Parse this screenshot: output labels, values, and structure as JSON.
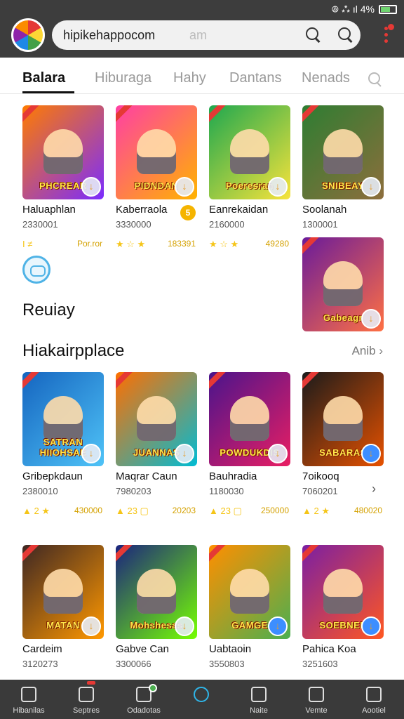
{
  "status": {
    "text": "ꔮ ⁂ ıl 4%"
  },
  "search": {
    "value": "hipikehappocom",
    "ghost": "am"
  },
  "tabs": [
    {
      "label": "Balara",
      "active": true
    },
    {
      "label": "Hiburaga",
      "active": false
    },
    {
      "label": "Hahy",
      "active": false
    },
    {
      "label": "Dantans",
      "active": false
    },
    {
      "label": "Nenads",
      "active": false
    }
  ],
  "row1": [
    {
      "title": "PHCREAR",
      "name": "Haluaphlan",
      "count": "2330001",
      "rating_prefix": "I  ≠",
      "score": "Por.ror",
      "colors": [
        "#ff7b00",
        "#7b2cff"
      ]
    },
    {
      "title": "PIDNDAN",
      "name": "Kaberraola",
      "count": "3330000",
      "rating_prefix": "★ ☆ ★",
      "score": "183391",
      "colors": [
        "#ff3fa4",
        "#ffb300"
      ]
    },
    {
      "title": "Poeresran",
      "name": "Eanrekaidan",
      "count": "2160000",
      "rating_prefix": "★ ☆ ★",
      "score": "49280",
      "colors": [
        "#1fa84f",
        "#f7e33b"
      ]
    },
    {
      "title": "SNIBEAY",
      "name": "Soolanah",
      "count": "1300001",
      "rating_prefix": "",
      "score": "",
      "colors": [
        "#2e7d32",
        "#8d6e3c"
      ]
    }
  ],
  "row1_extra": {
    "title": "Gabeagr",
    "colors": [
      "#6a1b9a",
      "#ff7043"
    ]
  },
  "section_recent": {
    "label": "Reuiay"
  },
  "section_market": {
    "label": "Hiakairpplace",
    "more": "Anib ›"
  },
  "row2": [
    {
      "title": "SATRAN HIIOHSAE",
      "name": "Gribepkdaun",
      "count": "2380010",
      "rating_prefix": "▲ 2 ★",
      "score": "430000",
      "colors": [
        "#1565c0",
        "#4fc3f7"
      ]
    },
    {
      "title": "JUANNAS",
      "name": "Maqrar Caun",
      "count": "7980203",
      "rating_prefix": "▲ 23 ▢",
      "score": "20203",
      "colors": [
        "#ff6f00",
        "#00bcd4"
      ]
    },
    {
      "title": "POWDUKDIS",
      "name": "Bauhradia",
      "count": "1180030",
      "rating_prefix": "▲ 23 ▢",
      "score": "250000",
      "colors": [
        "#4a148c",
        "#e91e63"
      ]
    },
    {
      "title": "SABARAS",
      "name": "7oikooq",
      "count": "7060201",
      "rating_prefix": "▲ 2 ★",
      "score": "480020",
      "colors": [
        "#1b1b1b",
        "#e65100"
      ]
    }
  ],
  "row3": [
    {
      "title": "MATAN",
      "name": "Cardeim",
      "count": "3120273",
      "colors": [
        "#3e2723",
        "#ff9800"
      ]
    },
    {
      "title": "Mohshesas",
      "name": "Gabve Can",
      "count": "3300066",
      "colors": [
        "#1a237e",
        "#76ff03"
      ]
    },
    {
      "title": "GAMGE",
      "name": "Uabtaoin",
      "count": "3550803",
      "colors": [
        "#ff8f00",
        "#4caf50"
      ]
    },
    {
      "title": "SOEBNEE",
      "name": "Pahica Koa",
      "count": "3251603",
      "colors": [
        "#7b1fa2",
        "#ff5722"
      ]
    }
  ],
  "bottom_nav": [
    {
      "label": "Hibanilas",
      "icon": "home-icon"
    },
    {
      "label": "Septres",
      "icon": "grid-icon"
    },
    {
      "label": "Odadotas",
      "icon": "badge-icon"
    },
    {
      "label": "",
      "icon": "music-icon"
    },
    {
      "label": "Naite",
      "icon": "square-icon"
    },
    {
      "label": "Vemte",
      "icon": "list-icon"
    },
    {
      "label": "Aootiel",
      "icon": "search-icon"
    }
  ]
}
